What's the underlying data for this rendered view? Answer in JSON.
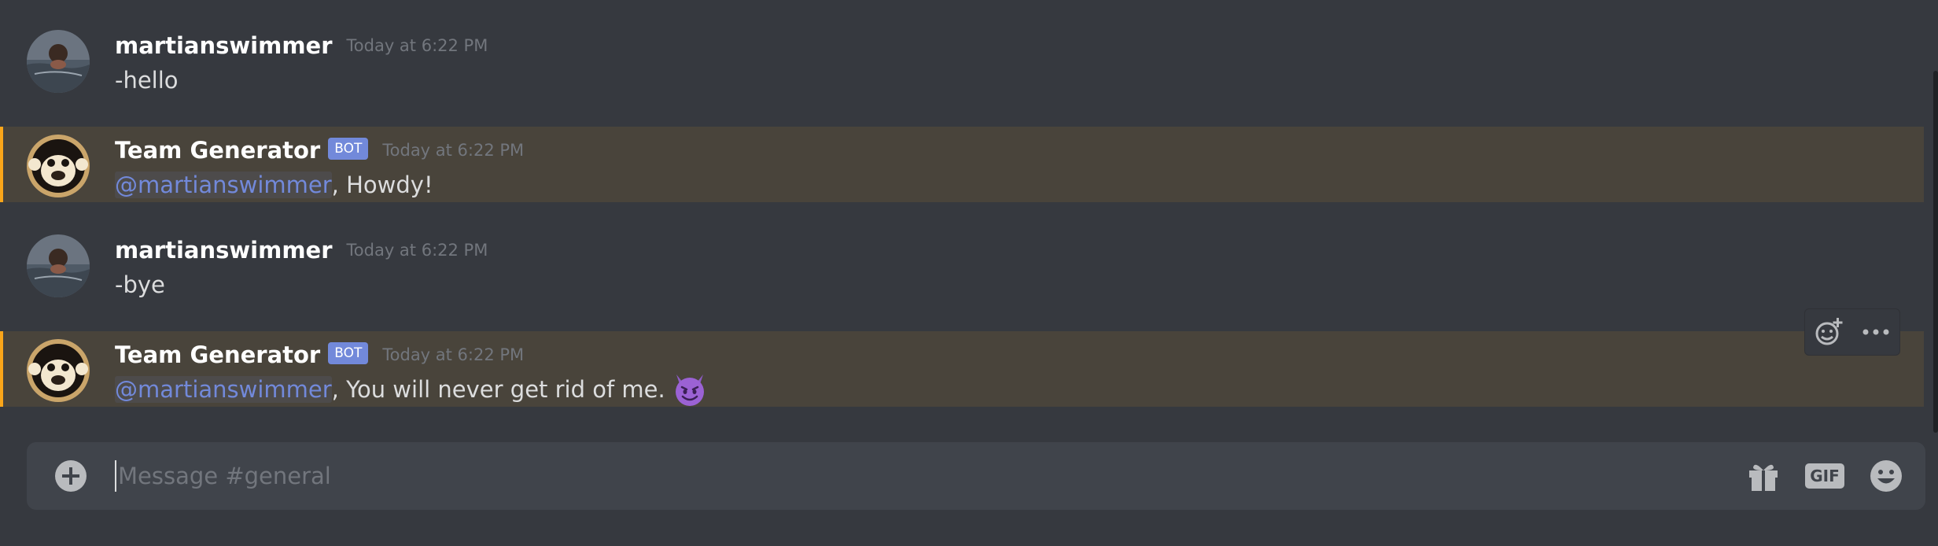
{
  "channel": {
    "name": "general"
  },
  "messages": [
    {
      "username": "martianswimmer",
      "timestamp": "Today at 6:22 PM",
      "content": "-hello",
      "is_bot": false,
      "highlighted": false
    },
    {
      "username": "Team Generator",
      "bot_tag": "BOT",
      "timestamp": "Today at 6:22 PM",
      "mention": "@martianswimmer",
      "content": ", Howdy!",
      "is_bot": true,
      "highlighted": true
    },
    {
      "username": "martianswimmer",
      "timestamp": "Today at 6:22 PM",
      "content": "-bye",
      "is_bot": false,
      "highlighted": false
    },
    {
      "username": "Team Generator",
      "bot_tag": "BOT",
      "timestamp": "Today at 6:22 PM",
      "mention": "@martianswimmer",
      "content": ", You will never get rid of me.",
      "emoji": "smiling-imp-icon",
      "is_bot": true,
      "highlighted": true
    }
  ],
  "hover_toolbar": {
    "icons": [
      "add-reaction-icon",
      "more-options-icon"
    ]
  },
  "composer": {
    "placeholder": "Message #general",
    "value": "",
    "icons": [
      "upload-plus-icon",
      "gift-icon",
      "gif-icon",
      "emoji-picker-icon"
    ],
    "gif_label": "GIF"
  },
  "colors": {
    "background": "#36393f",
    "mention_highlight_bar": "#faa61a",
    "bot_tag": "#7289da",
    "mention_text": "#7289da",
    "timestamp": "#72767d",
    "composer_bg": "#40444b"
  }
}
